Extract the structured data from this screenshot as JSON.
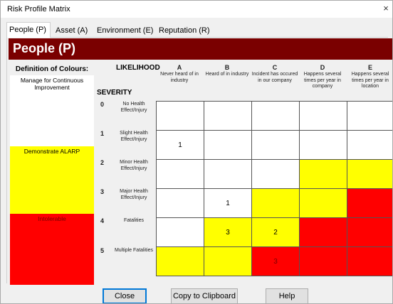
{
  "window": {
    "title": "Risk Profile Matrix",
    "close_glyph": "×"
  },
  "tabs": [
    {
      "label": "People (P)",
      "active": true
    },
    {
      "label": "Asset (A)",
      "active": false
    },
    {
      "label": "Environment (E)",
      "active": false
    },
    {
      "label": "Reputation (R)",
      "active": false
    }
  ],
  "header": {
    "title": "People (P)",
    "color": "#7a0000"
  },
  "legend": {
    "title": "Definition of Colours:",
    "bands": [
      {
        "label": "Manage for Continuous Improvement",
        "color": "#ffffff"
      },
      {
        "label": "Demonstrate ALARP",
        "color": "#ffff00"
      },
      {
        "label": "Intolerable",
        "color": "#ff0000"
      }
    ]
  },
  "matrix": {
    "likelihood_label": "LIKELIHOOD",
    "severity_label": "SEVERITY",
    "columns": [
      {
        "letter": "A",
        "text": "Never heard of in industry"
      },
      {
        "letter": "B",
        "text": "Heard of in industry"
      },
      {
        "letter": "C",
        "text": "Incident has occured in our company"
      },
      {
        "letter": "D",
        "text": "Happens several times per year in company"
      },
      {
        "letter": "E",
        "text": "Happens several times per year in location"
      }
    ],
    "rows": [
      {
        "num": "0",
        "text": "No Health Effect/Injury",
        "cells": [
          {
            "c": "w",
            "v": ""
          },
          {
            "c": "w",
            "v": ""
          },
          {
            "c": "w",
            "v": ""
          },
          {
            "c": "w",
            "v": ""
          },
          {
            "c": "w",
            "v": ""
          }
        ]
      },
      {
        "num": "1",
        "text": "Slight Health Effect/Injury",
        "cells": [
          {
            "c": "w",
            "v": "1"
          },
          {
            "c": "w",
            "v": ""
          },
          {
            "c": "w",
            "v": ""
          },
          {
            "c": "w",
            "v": ""
          },
          {
            "c": "w",
            "v": ""
          }
        ]
      },
      {
        "num": "2",
        "text": "Minor Health Effect/Injury",
        "cells": [
          {
            "c": "w",
            "v": ""
          },
          {
            "c": "w",
            "v": ""
          },
          {
            "c": "w",
            "v": ""
          },
          {
            "c": "y",
            "v": ""
          },
          {
            "c": "y",
            "v": ""
          }
        ]
      },
      {
        "num": "3",
        "text": "Major Health Effect/Injury",
        "cells": [
          {
            "c": "w",
            "v": ""
          },
          {
            "c": "w",
            "v": "1"
          },
          {
            "c": "y",
            "v": ""
          },
          {
            "c": "y",
            "v": ""
          },
          {
            "c": "r",
            "v": ""
          }
        ]
      },
      {
        "num": "4",
        "text": "Fatalities",
        "cells": [
          {
            "c": "w",
            "v": ""
          },
          {
            "c": "y",
            "v": "3"
          },
          {
            "c": "y",
            "v": "2"
          },
          {
            "c": "r",
            "v": ""
          },
          {
            "c": "r",
            "v": ""
          }
        ]
      },
      {
        "num": "5",
        "text": "Multiple Fatalities",
        "cells": [
          {
            "c": "y",
            "v": ""
          },
          {
            "c": "y",
            "v": ""
          },
          {
            "c": "r",
            "v": "3"
          },
          {
            "c": "r",
            "v": ""
          },
          {
            "c": "r",
            "v": ""
          }
        ]
      }
    ],
    "colors": {
      "w": "#ffffff",
      "y": "#ffff00",
      "r": "#ff0000"
    }
  },
  "buttons": {
    "close": "Close",
    "copy": "Copy to Clipboard",
    "help": "Help"
  }
}
